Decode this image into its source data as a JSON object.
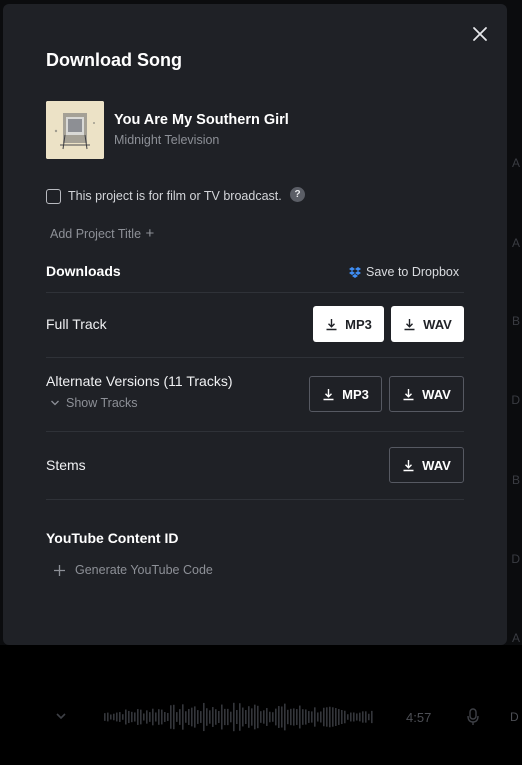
{
  "modal": {
    "title": "Download Song",
    "song": {
      "title": "You Are My Southern Girl",
      "artist": "Midnight Television"
    },
    "broadcast_checkbox": {
      "label": "This project is for film or TV broadcast.",
      "checked": false,
      "help": "?"
    },
    "add_project_title": "Add Project Title",
    "add_project_plus": "+",
    "downloads": {
      "heading": "Downloads",
      "save_to_dropbox": "Save to Dropbox",
      "rows": [
        {
          "label": "Full Track",
          "buttons": [
            "MP3",
            "WAV"
          ]
        },
        {
          "label": "Alternate Versions (11 Tracks)",
          "sub": "Show Tracks",
          "buttons": [
            "MP3",
            "WAV"
          ]
        },
        {
          "label": "Stems",
          "buttons": [
            "WAV"
          ]
        }
      ]
    },
    "youtube": {
      "heading": "YouTube Content ID",
      "generate": "Generate YouTube Code"
    }
  },
  "player": {
    "time": "4:57"
  },
  "background_letters": [
    "A",
    "A",
    "B",
    "D",
    "B",
    "D",
    "A"
  ],
  "background_row_letter": "D",
  "colors": {
    "modal_bg": "#1f2126",
    "page_bg": "#0b0c0e",
    "dropbox_blue": "#3f8ef5",
    "muted": "#8d9097"
  },
  "icons": [
    "close-icon",
    "checkbox-icon",
    "help-icon",
    "plus-icon",
    "dropbox-icon",
    "download-icon",
    "chevron-down-icon",
    "waveform-icon",
    "microphone-icon"
  ]
}
